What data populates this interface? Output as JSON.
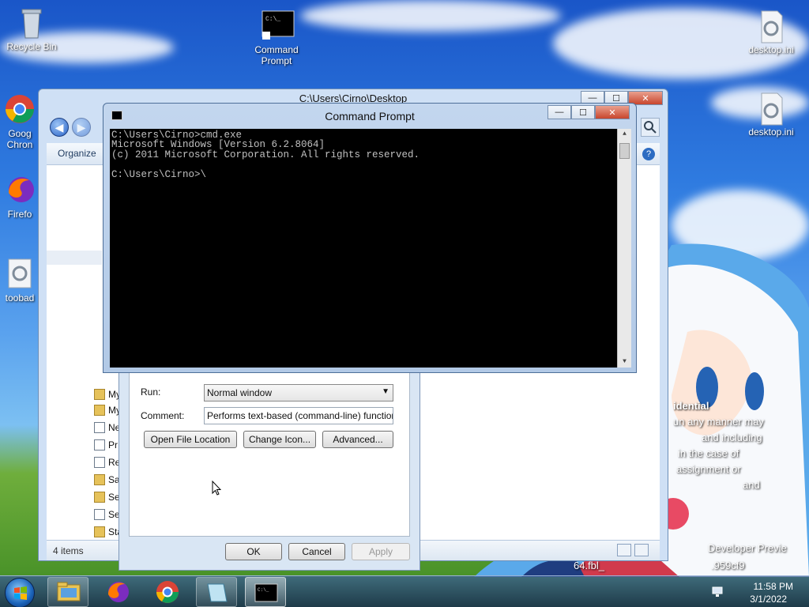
{
  "desktop": {
    "icons": [
      {
        "label": "Recycle Bin",
        "icon": "recycle-bin-icon"
      },
      {
        "label": "Command Prompt",
        "icon": "command-prompt-icon"
      },
      {
        "label": "desktop.ini",
        "icon": "settings-file-icon"
      },
      {
        "label": "desktop.ini",
        "icon": "settings-file-icon"
      },
      {
        "label": "Goog Chron",
        "icon": "chrome-icon"
      },
      {
        "label": "Firefo",
        "icon": "firefox-icon"
      },
      {
        "label": "toobad",
        "icon": "settings-file-icon"
      }
    ],
    "watermark": {
      "line1": "idential",
      "line2": "un any manner may",
      "line3": "and including",
      "line4": "in the case of",
      "line5": "assignment or",
      "line6": "and",
      "build1": "Developer Previe",
      "build2": "64.fbl_",
      "build3": ".959cf9"
    }
  },
  "explorer": {
    "title": "C:\\Users\\Cirno\\Desktop",
    "organize": "Organize",
    "status_items": "4 items",
    "nav_items": [
      "My",
      "My",
      "Ne",
      "Pr",
      "Re",
      "Sa",
      "Se",
      "Se",
      "Sta"
    ]
  },
  "properties": {
    "run_label": "Run:",
    "run_value": "Normal window",
    "comment_label": "Comment:",
    "comment_value": "Performs text-based (command-line) functions.",
    "open_location": "Open File Location",
    "change_icon": "Change Icon...",
    "advanced": "Advanced...",
    "ok": "OK",
    "cancel": "Cancel",
    "apply": "Apply"
  },
  "cmd": {
    "title": "Command Prompt",
    "lines": [
      "C:\\Users\\Cirno>cmd.exe",
      "Microsoft Windows [Version 6.2.8064]",
      "(c) 2011 Microsoft Corporation. All rights reserved.",
      "",
      "C:\\Users\\Cirno>\\"
    ]
  },
  "taskbar": {
    "items": [
      "start-button",
      "explorer-icon",
      "firefox-icon",
      "chrome-icon",
      "notepad-icon",
      "cmd-icon"
    ],
    "time": "11:58 PM",
    "date": "3/1/2022"
  }
}
